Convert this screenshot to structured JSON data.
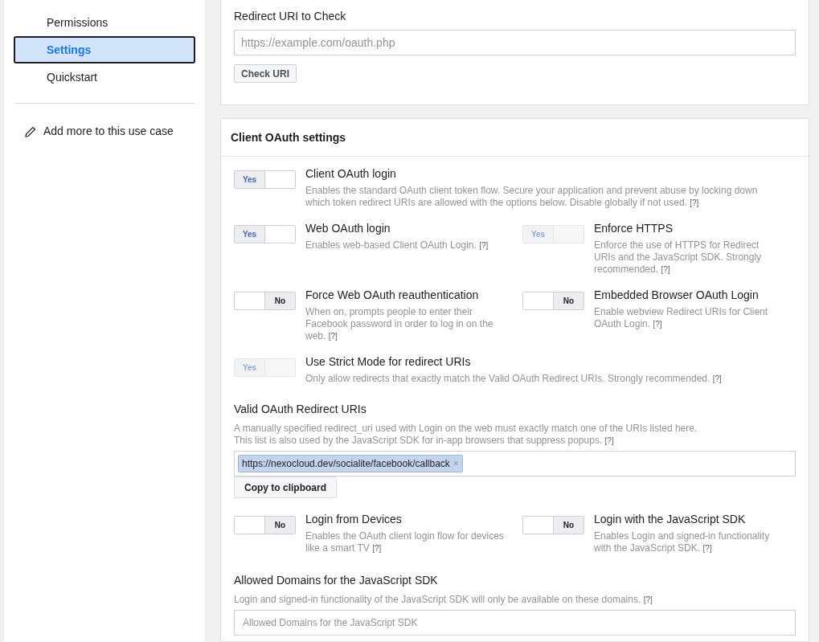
{
  "sidebar": {
    "items": [
      {
        "label": "Permissions",
        "selected": false
      },
      {
        "label": "Settings",
        "selected": true
      },
      {
        "label": "Quickstart",
        "selected": false
      }
    ],
    "action": "Add more to this use case"
  },
  "redirect_check": {
    "label": "Redirect URI to Check",
    "placeholder": "https://example.com/oauth.php",
    "button": "Check URI"
  },
  "client_oauth": {
    "title": "Client OAuth settings",
    "sections": [
      {
        "kind": "toggles",
        "items": [
          {
            "title": "Client OAuth login",
            "description": "Enables the standard OAuth client token flow. Secure your application and prevent abuse by locking down which token redirect URIs are allowed with the options below. Disable globally if not used.",
            "help": "[?]",
            "on": true,
            "disabled": false,
            "toggle_label": "Yes"
          }
        ]
      },
      {
        "kind": "toggles",
        "items": [
          {
            "title": "Web OAuth login",
            "description": "Enables web-based Client OAuth Login.",
            "help": "[?]",
            "on": true,
            "disabled": false,
            "toggle_label": "Yes"
          },
          {
            "title": "Enforce HTTPS",
            "description": "Enforce the use of HTTPS for Redirect URIs and the JavaScript SDK. Strongly recommended.",
            "help": "[?]",
            "on": true,
            "disabled": true,
            "toggle_label": "Yes"
          }
        ]
      },
      {
        "kind": "toggles",
        "items": [
          {
            "title": "Force Web OAuth reauthentication",
            "description": "When on, prompts people to enter their Facebook password in order to log in on the web.",
            "help": "[?]",
            "on": false,
            "disabled": false,
            "toggle_label": "No"
          },
          {
            "title": "Embedded Browser OAuth Login",
            "description": "Enable webview Redirect URIs for Client OAuth Login.",
            "help": "[?]",
            "on": false,
            "disabled": false,
            "toggle_label": "No"
          }
        ]
      },
      {
        "kind": "toggles",
        "items": [
          {
            "title": "Use Strict Mode for redirect URIs",
            "description": "Only allow redirects that exactly match the Valid OAuth Redirect URIs. Strongly recommended.",
            "help": "[?]",
            "on": true,
            "disabled": true,
            "toggle_label": "Yes"
          }
        ]
      },
      {
        "kind": "uri_list",
        "label": "Valid OAuth Redirect URIs",
        "description": [
          "A manually specified redirect_uri used with Login on the web must exactly match one of the URIs listed here.",
          "This list is also used by the JavaScript SDK for in-app browsers that suppress popups."
        ],
        "help": "[?]",
        "tags": [
          {
            "text": "https://nexocloud.dev/socialite/facebook/callback",
            "remove": "×"
          }
        ],
        "button": "Copy to clipboard"
      },
      {
        "kind": "toggles",
        "items": [
          {
            "title": "Login from Devices",
            "description": "Enables the OAuth client login flow for devices like a smart TV",
            "help": "[?]",
            "on": false,
            "disabled": false,
            "toggle_label": "No"
          },
          {
            "title": "Login with the JavaScript SDK",
            "description": "Enables Login and signed-in functionality with the JavaScript SDK.",
            "help": "[?]",
            "on": false,
            "disabled": false,
            "toggle_label": "No"
          }
        ]
      },
      {
        "kind": "text_field",
        "label": "Allowed Domains for the JavaScript SDK",
        "description": [
          "Login and signed-in functionality of the JavaScript SDK will only be available on these domains."
        ],
        "help": "[?]",
        "placeholder": "Allowed Domains for the JavaScript SDK"
      }
    ]
  }
}
